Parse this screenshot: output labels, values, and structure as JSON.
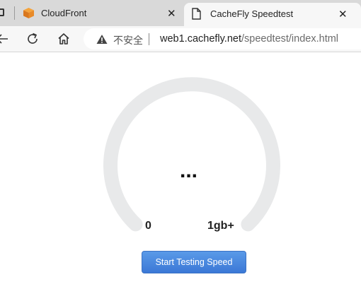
{
  "browser": {
    "tabs": [
      {
        "title": "CloudFront",
        "icon": "cloudfront-box-icon",
        "active": false
      },
      {
        "title": "CacheFly Speedtest",
        "icon": "document-icon",
        "active": true
      }
    ],
    "close_glyph": "✕",
    "security_label": "不安全",
    "url_host": "web1.cachefly.net",
    "url_path": "/speedtest/index.html"
  },
  "speedtest": {
    "gauge_value": "...",
    "gauge_min": "0",
    "gauge_max": "1gb+",
    "start_button": "Start Testing Speed"
  },
  "colors": {
    "gauge_track": "#e8e9ea",
    "button": "#4a88de"
  }
}
